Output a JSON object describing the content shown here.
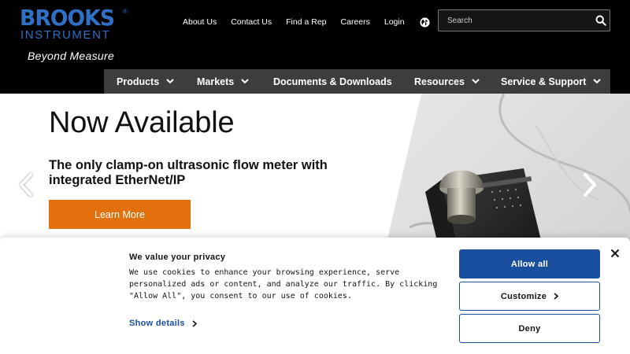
{
  "header": {
    "logo": {
      "brand": "BROOKS",
      "sub": "INSTRUMENT",
      "reg_mark": "®",
      "tagline": "Beyond Measure"
    },
    "top_links": [
      "About Us",
      "Contact Us",
      "Find a Rep",
      "Careers",
      "Login"
    ],
    "language_icon": "globe-icon",
    "search": {
      "placeholder": "Search",
      "icon": "search-icon"
    }
  },
  "nav": {
    "items": [
      {
        "label": "Products",
        "has_dropdown": true
      },
      {
        "label": "Markets",
        "has_dropdown": true
      },
      {
        "label": "Documents & Downloads",
        "has_dropdown": false
      },
      {
        "label": "Resources",
        "has_dropdown": true
      },
      {
        "label": "Service & Support",
        "has_dropdown": true
      }
    ]
  },
  "hero": {
    "title": "Now Available",
    "subtitle": "The only clamp-on ultrasonic flow meter with integrated EtherNet/IP",
    "cta_label": "Learn More",
    "prev_icon": "chevron-left-icon",
    "next_icon": "chevron-right-icon"
  },
  "cookie_banner": {
    "title": "We value your privacy",
    "text": "We use cookies to enhance your browsing experience, serve personalized ads or content, and analyze our traffic. By clicking \"Allow All\", you consent to our use of cookies.",
    "show_details_label": "Show details",
    "allow_all_label": "Allow all",
    "customize_label": "Customize",
    "deny_label": "Deny",
    "close_icon": "close-icon"
  },
  "colors": {
    "brand_blue": "#2f6fc4",
    "nav_bar": "#3d3d3d",
    "cta_orange": "#e2700d",
    "cookie_blue": "#1a4fa0"
  }
}
